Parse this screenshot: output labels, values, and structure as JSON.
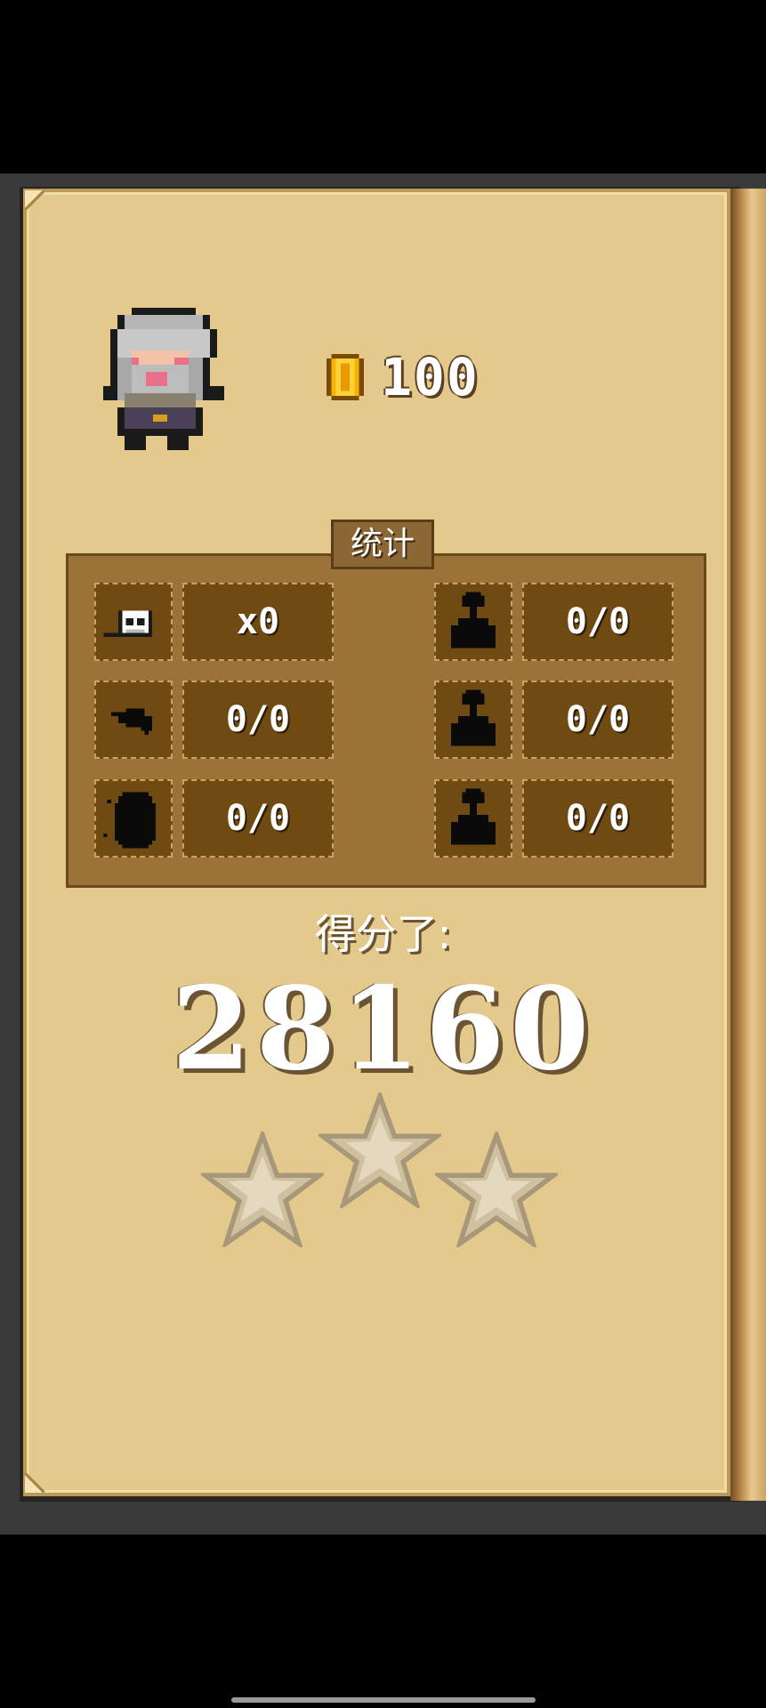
{
  "coins": {
    "value": "100"
  },
  "stats": {
    "title": "统计",
    "left": [
      {
        "icon": "skull-icon",
        "value": "x0"
      },
      {
        "icon": "rat-icon",
        "value": "0/0"
      },
      {
        "icon": "shadow-creature-icon",
        "value": "0/0"
      }
    ],
    "right": [
      {
        "icon": "potion-bottle-icon",
        "value": "0/0"
      },
      {
        "icon": "potion-bottle-icon",
        "value": "0/0"
      },
      {
        "icon": "potion-bottle-icon",
        "value": "0/0"
      }
    ]
  },
  "score": {
    "label": "得分了:",
    "value": "28160"
  },
  "stars": {
    "earned": 0,
    "total": 3
  },
  "colors": {
    "page": "#e3c98c",
    "panel": "#9b7338",
    "cell": "#6f4a12",
    "star_empty": "#cfc0a0"
  }
}
